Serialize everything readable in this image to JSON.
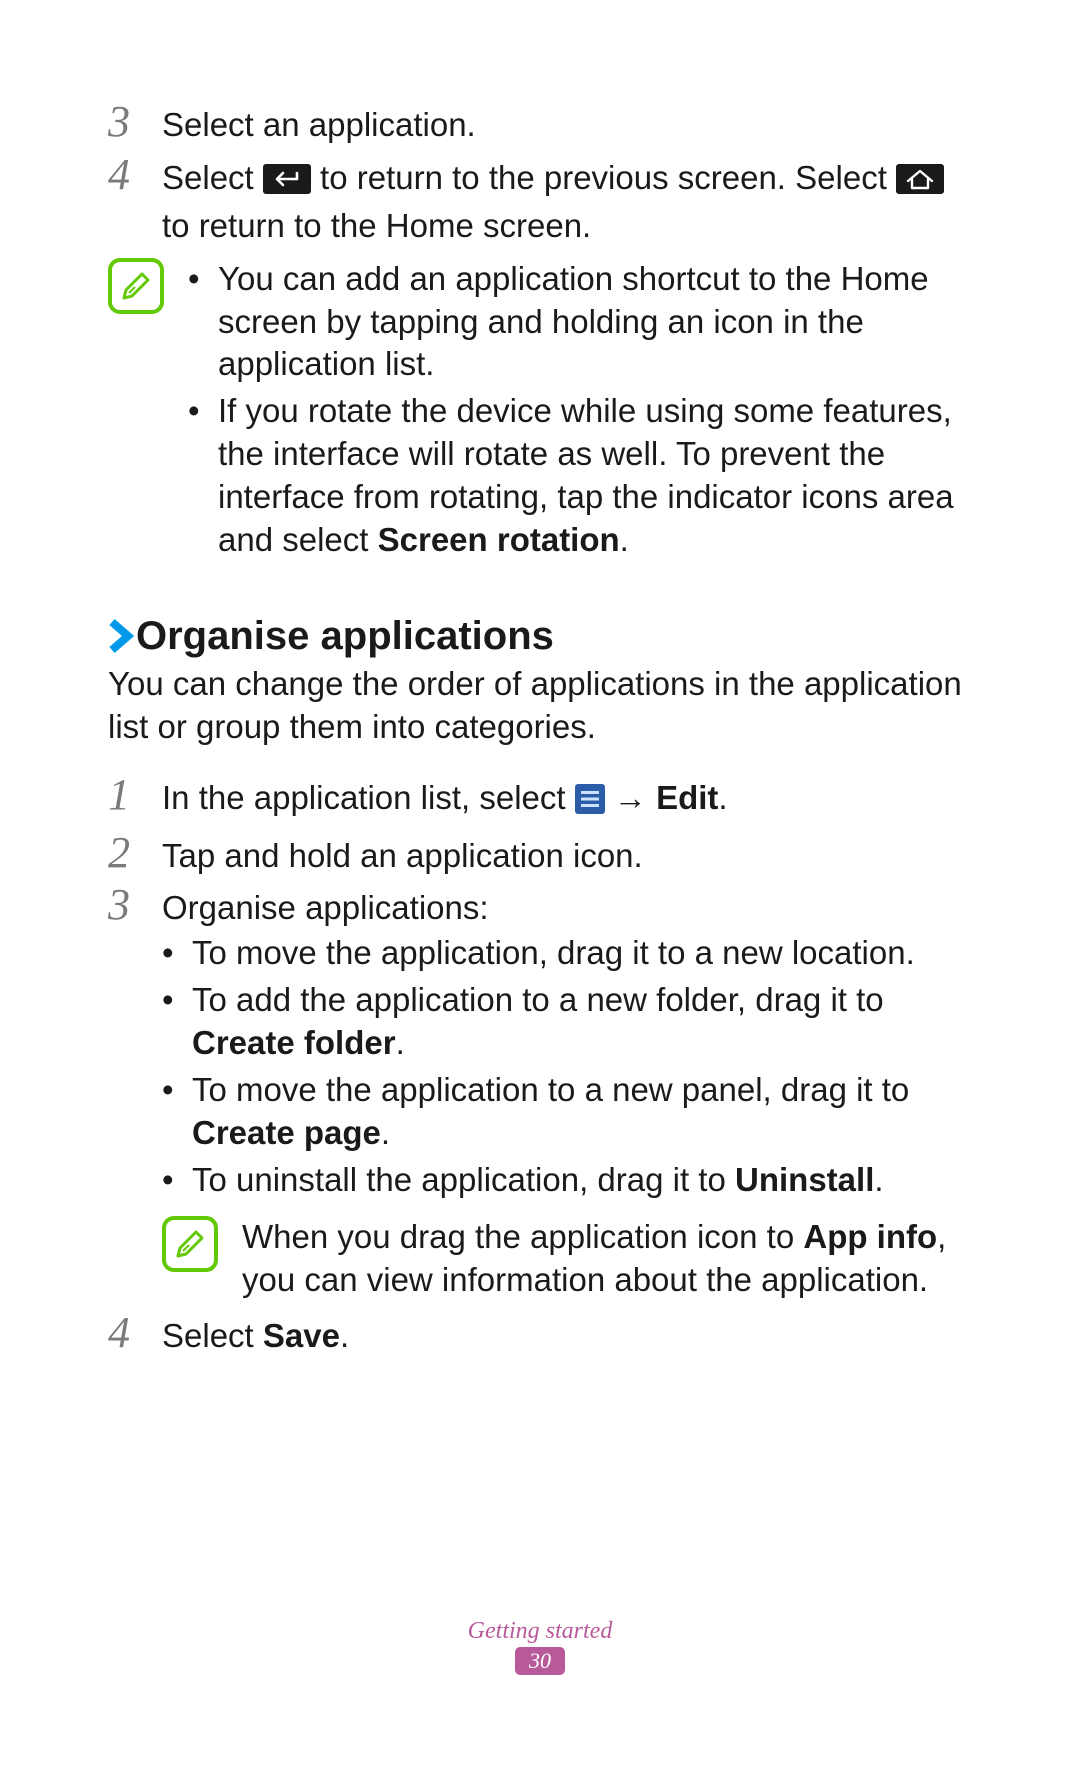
{
  "steps_top": {
    "s3": {
      "num": "3",
      "text": "Select an application."
    },
    "s4": {
      "num": "4",
      "pre": "Select ",
      "mid": " to return to the previous screen. Select ",
      "post": " to return to the Home screen."
    }
  },
  "note_top": {
    "b1": "You can add an application shortcut to the Home screen by tapping and holding an icon in the application list.",
    "b2_pre": "If you rotate the device while using some features, the interface will rotate as well. To prevent the interface from rotating, tap the indicator icons area and select ",
    "b2_bold": "Screen rotation",
    "b2_post": "."
  },
  "section": {
    "title": "Organise applications",
    "desc": "You can change the order of applications in the application list or group them into categories."
  },
  "steps_mid": {
    "s1": {
      "num": "1",
      "pre": "In the application list, select ",
      "arrow": " → ",
      "bold": "Edit",
      "post": "."
    },
    "s2": {
      "num": "2",
      "text": "Tap and hold an application icon."
    },
    "s3": {
      "num": "3",
      "lead": "Organise applications:",
      "b1": "To move the application, drag it to a new location.",
      "b2_pre": "To add the application to a new folder, drag it to ",
      "b2_bold": "Create folder",
      "b2_post": ".",
      "b3_pre": "To move the application to a new panel, drag it to ",
      "b3_bold": "Create page",
      "b3_post": ".",
      "b4_pre": "To uninstall the application, drag it to ",
      "b4_bold": "Uninstall",
      "b4_post": "."
    }
  },
  "note_mid": {
    "pre": "When you drag the application icon to ",
    "bold": "App info",
    "post": ", you can view information about the application."
  },
  "steps_end": {
    "s4": {
      "num": "4",
      "pre": "Select ",
      "bold": "Save",
      "post": "."
    }
  },
  "footer": {
    "chapter": "Getting started",
    "page": "30"
  }
}
